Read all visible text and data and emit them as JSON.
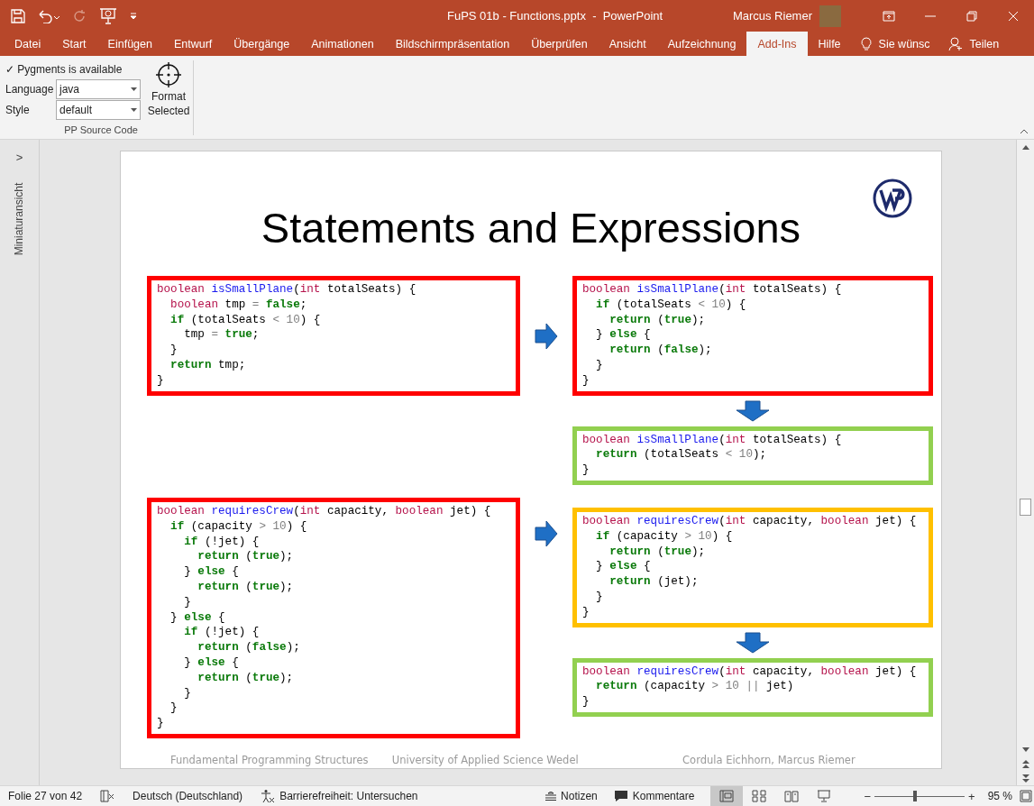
{
  "window": {
    "title": "FuPS 01b - Functions.pptx  -  PowerPoint",
    "user": "Marcus Riemer"
  },
  "ribbon_tabs": [
    {
      "label": "Datei",
      "selected": false
    },
    {
      "label": "Start",
      "selected": false
    },
    {
      "label": "Einfügen",
      "selected": false
    },
    {
      "label": "Entwurf",
      "selected": false
    },
    {
      "label": "Übergänge",
      "selected": false
    },
    {
      "label": "Animationen",
      "selected": false
    },
    {
      "label": "Bildschirmpräsentation",
      "selected": false
    },
    {
      "label": "Überprüfen",
      "selected": false
    },
    {
      "label": "Ansicht",
      "selected": false
    },
    {
      "label": "Aufzeichnung",
      "selected": false
    },
    {
      "label": "Add-Ins",
      "selected": true
    },
    {
      "label": "Hilfe",
      "selected": false
    }
  ],
  "tell_me": "Sie wünsc",
  "share": "Teilen",
  "ribbon": {
    "status": "✓ Pygments is available",
    "language_label": "Language",
    "language": "java",
    "style_label": "Style",
    "style": "default",
    "format_button": "Format Selected",
    "group_label": "PP Source Code"
  },
  "thumbnail_pane": {
    "label": "Miniaturansicht",
    "toggle": ">"
  },
  "slide": {
    "title": "Statements and Expressions",
    "sections": [
      {
        "source": {
          "color": "#ff0000",
          "lines": [
            [
              {
                "kind": "type",
                "text": "boolean"
              },
              {
                "kind": "name",
                "text": " isSmallPlane"
              },
              {
                "kind": "plain",
                "text": "("
              },
              {
                "kind": "type",
                "text": "int"
              },
              {
                "kind": "plain",
                "text": " totalSeats) {"
              }
            ],
            [
              {
                "kind": "type",
                "text": "  boolean"
              },
              {
                "kind": "plain",
                "text": " tmp "
              },
              {
                "kind": "operator",
                "text": "="
              },
              {
                "kind": "keyword",
                "text": " false"
              },
              {
                "kind": "plain",
                "text": ";"
              }
            ],
            [
              {
                "kind": "keyword",
                "text": "  if"
              },
              {
                "kind": "plain",
                "text": " (totalSeats "
              },
              {
                "kind": "operator",
                "text": "<"
              },
              {
                "kind": "operator",
                "text": " 10"
              },
              {
                "kind": "plain",
                "text": ") {"
              }
            ],
            [
              {
                "kind": "plain",
                "text": "    tmp "
              },
              {
                "kind": "operator",
                "text": "="
              },
              {
                "kind": "keyword",
                "text": " true"
              },
              {
                "kind": "plain",
                "text": ";"
              }
            ],
            [
              {
                "kind": "plain",
                "text": "  }"
              }
            ],
            [
              {
                "kind": "keyword",
                "text": "  return"
              },
              {
                "kind": "plain",
                "text": " tmp;"
              }
            ],
            [
              {
                "kind": "plain",
                "text": "}"
              }
            ]
          ]
        },
        "steps": [
          {
            "color": "#ff0000",
            "lines": [
              [
                {
                  "kind": "type",
                  "text": "boolean"
                },
                {
                  "kind": "name",
                  "text": " isSmallPlane"
                },
                {
                  "kind": "plain",
                  "text": "("
                },
                {
                  "kind": "type",
                  "text": "int"
                },
                {
                  "kind": "plain",
                  "text": " totalSeats) {"
                }
              ],
              [
                {
                  "kind": "keyword",
                  "text": "  if"
                },
                {
                  "kind": "plain",
                  "text": " (totalSeats "
                },
                {
                  "kind": "operator",
                  "text": "<"
                },
                {
                  "kind": "operator",
                  "text": " 10"
                },
                {
                  "kind": "plain",
                  "text": ") {"
                }
              ],
              [
                {
                  "kind": "keyword",
                  "text": "    return"
                },
                {
                  "kind": "plain",
                  "text": " ("
                },
                {
                  "kind": "keyword",
                  "text": "true"
                },
                {
                  "kind": "plain",
                  "text": ");"
                }
              ],
              [
                {
                  "kind": "plain",
                  "text": "  } "
                },
                {
                  "kind": "keyword",
                  "text": "else"
                },
                {
                  "kind": "plain",
                  "text": " {"
                }
              ],
              [
                {
                  "kind": "keyword",
                  "text": "    return"
                },
                {
                  "kind": "plain",
                  "text": " ("
                },
                {
                  "kind": "keyword",
                  "text": "false"
                },
                {
                  "kind": "plain",
                  "text": ");"
                }
              ],
              [
                {
                  "kind": "plain",
                  "text": "  }"
                }
              ],
              [
                {
                  "kind": "plain",
                  "text": "}"
                }
              ]
            ]
          },
          {
            "color": "#92d050",
            "lines": [
              [
                {
                  "kind": "type",
                  "text": "boolean"
                },
                {
                  "kind": "name",
                  "text": " isSmallPlane"
                },
                {
                  "kind": "plain",
                  "text": "("
                },
                {
                  "kind": "type",
                  "text": "int"
                },
                {
                  "kind": "plain",
                  "text": " totalSeats) {"
                }
              ],
              [
                {
                  "kind": "keyword",
                  "text": "  return"
                },
                {
                  "kind": "plain",
                  "text": " (totalSeats "
                },
                {
                  "kind": "operator",
                  "text": "<"
                },
                {
                  "kind": "operator",
                  "text": " 10"
                },
                {
                  "kind": "plain",
                  "text": ");"
                }
              ],
              [
                {
                  "kind": "plain",
                  "text": "}"
                }
              ]
            ]
          }
        ]
      },
      {
        "source": {
          "color": "#ff0000",
          "lines": [
            [
              {
                "kind": "type",
                "text": "boolean"
              },
              {
                "kind": "name",
                "text": " requiresCrew"
              },
              {
                "kind": "plain",
                "text": "("
              },
              {
                "kind": "type",
                "text": "int"
              },
              {
                "kind": "plain",
                "text": " capacity, "
              },
              {
                "kind": "type",
                "text": "boolean"
              },
              {
                "kind": "plain",
                "text": " jet) {"
              }
            ],
            [
              {
                "kind": "keyword",
                "text": "  if"
              },
              {
                "kind": "plain",
                "text": " (capacity "
              },
              {
                "kind": "operator",
                "text": ">"
              },
              {
                "kind": "operator",
                "text": " 10"
              },
              {
                "kind": "plain",
                "text": ") {"
              }
            ],
            [
              {
                "kind": "keyword",
                "text": "    if"
              },
              {
                "kind": "plain",
                "text": " (!jet) {"
              }
            ],
            [
              {
                "kind": "keyword",
                "text": "      return"
              },
              {
                "kind": "plain",
                "text": " ("
              },
              {
                "kind": "keyword",
                "text": "true"
              },
              {
                "kind": "plain",
                "text": ");"
              }
            ],
            [
              {
                "kind": "plain",
                "text": "    } "
              },
              {
                "kind": "keyword",
                "text": "else"
              },
              {
                "kind": "plain",
                "text": " {"
              }
            ],
            [
              {
                "kind": "keyword",
                "text": "      return"
              },
              {
                "kind": "plain",
                "text": " ("
              },
              {
                "kind": "keyword",
                "text": "true"
              },
              {
                "kind": "plain",
                "text": ");"
              }
            ],
            [
              {
                "kind": "plain",
                "text": "    }"
              }
            ],
            [
              {
                "kind": "plain",
                "text": "  } "
              },
              {
                "kind": "keyword",
                "text": "else"
              },
              {
                "kind": "plain",
                "text": " {"
              }
            ],
            [
              {
                "kind": "keyword",
                "text": "    if"
              },
              {
                "kind": "plain",
                "text": " (!jet) {"
              }
            ],
            [
              {
                "kind": "keyword",
                "text": "      return"
              },
              {
                "kind": "plain",
                "text": " ("
              },
              {
                "kind": "keyword",
                "text": "false"
              },
              {
                "kind": "plain",
                "text": ");"
              }
            ],
            [
              {
                "kind": "plain",
                "text": "    } "
              },
              {
                "kind": "keyword",
                "text": "else"
              },
              {
                "kind": "plain",
                "text": " {"
              }
            ],
            [
              {
                "kind": "keyword",
                "text": "      return"
              },
              {
                "kind": "plain",
                "text": " ("
              },
              {
                "kind": "keyword",
                "text": "true"
              },
              {
                "kind": "plain",
                "text": ");"
              }
            ],
            [
              {
                "kind": "plain",
                "text": "    }"
              }
            ],
            [
              {
                "kind": "plain",
                "text": "  }"
              }
            ],
            [
              {
                "kind": "plain",
                "text": "}"
              }
            ]
          ]
        },
        "steps": [
          {
            "color": "#ffc000",
            "lines": [
              [
                {
                  "kind": "type",
                  "text": "boolean"
                },
                {
                  "kind": "name",
                  "text": " requiresCrew"
                },
                {
                  "kind": "plain",
                  "text": "("
                },
                {
                  "kind": "type",
                  "text": "int"
                },
                {
                  "kind": "plain",
                  "text": " capacity, "
                },
                {
                  "kind": "type",
                  "text": "boolean"
                },
                {
                  "kind": "plain",
                  "text": " jet) {"
                }
              ],
              [
                {
                  "kind": "keyword",
                  "text": "  if"
                },
                {
                  "kind": "plain",
                  "text": " (capacity "
                },
                {
                  "kind": "operator",
                  "text": ">"
                },
                {
                  "kind": "operator",
                  "text": " 10"
                },
                {
                  "kind": "plain",
                  "text": ") {"
                }
              ],
              [
                {
                  "kind": "keyword",
                  "text": "    return"
                },
                {
                  "kind": "plain",
                  "text": " ("
                },
                {
                  "kind": "keyword",
                  "text": "true"
                },
                {
                  "kind": "plain",
                  "text": ");"
                }
              ],
              [
                {
                  "kind": "plain",
                  "text": "  } "
                },
                {
                  "kind": "keyword",
                  "text": "else"
                },
                {
                  "kind": "plain",
                  "text": " {"
                }
              ],
              [
                {
                  "kind": "keyword",
                  "text": "    return"
                },
                {
                  "kind": "plain",
                  "text": " (jet);"
                }
              ],
              [
                {
                  "kind": "plain",
                  "text": "  }"
                }
              ],
              [
                {
                  "kind": "plain",
                  "text": "}"
                }
              ]
            ]
          },
          {
            "color": "#92d050",
            "lines": [
              [
                {
                  "kind": "type",
                  "text": "boolean"
                },
                {
                  "kind": "name",
                  "text": " requiresCrew"
                },
                {
                  "kind": "plain",
                  "text": "("
                },
                {
                  "kind": "type",
                  "text": "int"
                },
                {
                  "kind": "plain",
                  "text": " capacity, "
                },
                {
                  "kind": "type",
                  "text": "boolean"
                },
                {
                  "kind": "plain",
                  "text": " jet) {"
                }
              ],
              [
                {
                  "kind": "keyword",
                  "text": "  return"
                },
                {
                  "kind": "plain",
                  "text": " (capacity "
                },
                {
                  "kind": "operator",
                  "text": ">"
                },
                {
                  "kind": "operator",
                  "text": " 10 ||"
                },
                {
                  "kind": "plain",
                  "text": " jet)"
                }
              ],
              [
                {
                  "kind": "plain",
                  "text": "}"
                }
              ]
            ]
          }
        ]
      }
    ],
    "footer": [
      "Fundamental Programming Structures",
      "University of Applied Science Wedel",
      "Cordula Eichhorn, Marcus Riemer"
    ]
  },
  "status_bar": {
    "slide": "Folie 27 von 42",
    "language": "Deutsch (Deutschland)",
    "accessibility": "Barrierefreiheit: Untersuchen",
    "notes": "Notizen",
    "comments": "Kommentare",
    "views": [
      {
        "selected": true
      },
      {
        "selected": false
      },
      {
        "selected": false
      },
      {
        "selected": false
      }
    ],
    "zoom_minus": "−",
    "zoom_plus": "+",
    "zoom": {
      "level": 0.45
    },
    "zoom_text": "95 %"
  }
}
